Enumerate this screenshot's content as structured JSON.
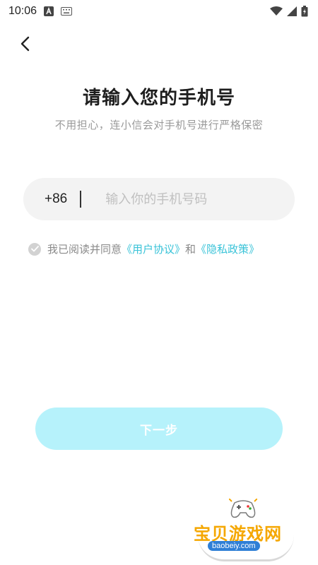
{
  "status_bar": {
    "time": "10:06",
    "icons": [
      "notification-a-icon",
      "keyboard-icon",
      "wifi-icon",
      "signal-icon",
      "battery-icon"
    ]
  },
  "header": {
    "back_icon": "chevron-left-icon",
    "title": "请输入您的手机号",
    "subtitle": "不用担心，连小信会对手机号进行严格保密"
  },
  "phone": {
    "country_code": "+86",
    "placeholder": "输入你的手机号码",
    "value": ""
  },
  "agreement": {
    "checked": false,
    "prefix": "我已阅读并同意",
    "user_agreement": "《用户协议》",
    "and": "和",
    "privacy_policy": "《隐私政策》"
  },
  "actions": {
    "next_label": "下一步"
  },
  "watermark": {
    "brand": "宝贝游戏网",
    "url": "baobeiy.com"
  },
  "colors": {
    "link": "#39c3d8",
    "button_disabled": "#b6f2fb",
    "input_bg": "#f3f3f3"
  }
}
